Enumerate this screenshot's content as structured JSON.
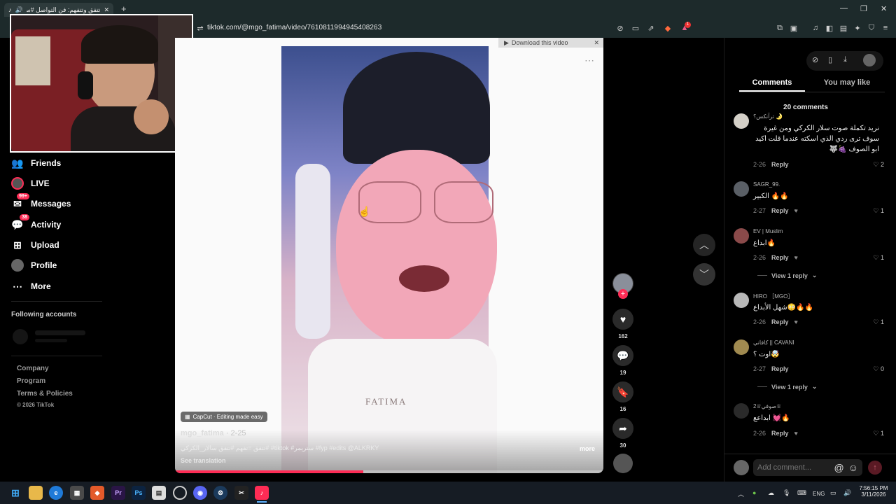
{
  "browser": {
    "tab_title": "تتفق وتتفهم: فن التواصل #ستر",
    "url": "tiktok.com/@mgo_fatima/video/7610811994945408263",
    "download_label": "Download this video",
    "notif_count": "1"
  },
  "sidebar": {
    "items": [
      {
        "label": "Friends",
        "icon": "friends-icon"
      },
      {
        "label": "LIVE",
        "icon": "live-icon"
      },
      {
        "label": "Messages",
        "icon": "messages-icon",
        "badge": "99+"
      },
      {
        "label": "Activity",
        "icon": "activity-icon",
        "badge": "38"
      },
      {
        "label": "Upload",
        "icon": "upload-icon"
      },
      {
        "label": "Profile",
        "icon": "profile-icon"
      },
      {
        "label": "More",
        "icon": "more-icon"
      }
    ],
    "following_title": "Following accounts",
    "footer": [
      "Company",
      "Program",
      "Terms & Policies",
      "© 2026 TikTok"
    ]
  },
  "video": {
    "author": "mgo_fatima",
    "date": "· 2-25",
    "caption": "تتفق =تفهم #تتفق سالار_الكركي# #tiktok #ستريمر #fyp #edits @ALKRKY",
    "more_label": "more",
    "translation_label": "See translation",
    "capcut_label": "CapCut · Editing made easy",
    "watermark": "FATIMA",
    "progress": 0.44
  },
  "actions": {
    "likes": "162",
    "comments": "19",
    "saves": "16",
    "shares": "30"
  },
  "panel": {
    "tabs": [
      "Comments",
      "You may like"
    ],
    "comment_count": "20 comments",
    "reply_label": "Reply",
    "add_comment_placeholder": "Add comment...",
    "comments": [
      {
        "user": "ترآنكس؟ 🌛",
        "text": "نريد تكملة صوت سلار الكركي ومن غيرة سوف ترى ردي الذي اسكته عندما قلت اكيد ابو الصوف 🍇🐺",
        "date": "2-26",
        "likes": "2"
      },
      {
        "user": "SAGR_99.",
        "text": "الكبير 🔥🔥",
        "date": "2-27",
        "likes": "1"
      },
      {
        "user": "EV | Muslim",
        "text": "ابداع🔥",
        "date": "2-26",
        "likes": "1",
        "view_replies": "View 1 reply"
      },
      {
        "user": "HIRO ［MGO］",
        "text": "شهل الأبداع😳🔥🔥",
        "date": "2-26",
        "likes": "1"
      },
      {
        "user": "كافاني || CAVANI",
        "text": "اوت ؟🤯",
        "date": "2-27",
        "likes": "0",
        "view_replies": "View 1 reply"
      },
      {
        "user": "صوفي♕2♕",
        "text": "ابداعع 💓🔥",
        "date": "2-26",
        "likes": "1"
      }
    ]
  },
  "taskbar": {
    "lang": "ENG",
    "time": "7:56:15 PM",
    "date": "3/11/2026"
  }
}
